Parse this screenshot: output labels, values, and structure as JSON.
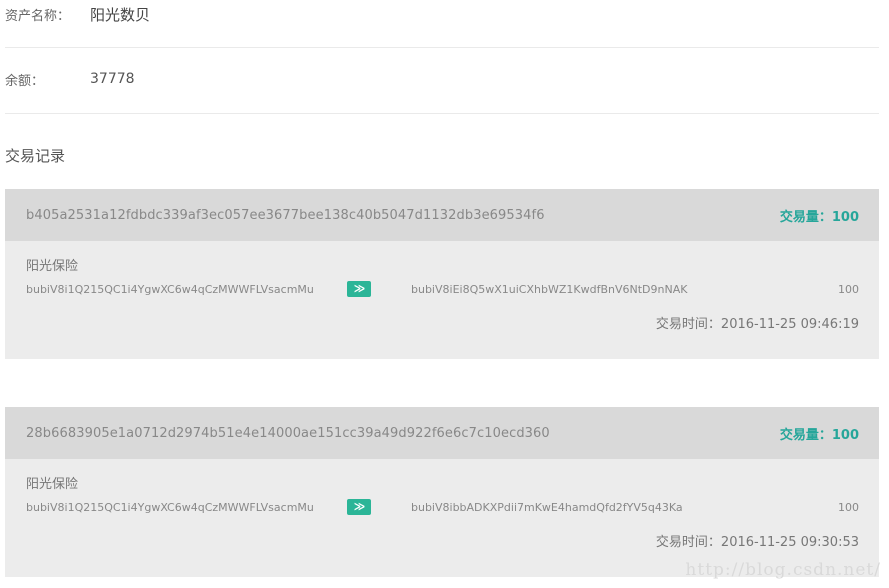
{
  "asset": {
    "label": "资产名称：",
    "value": "阳光数贝"
  },
  "balance": {
    "label": "余额：",
    "value": "37778"
  },
  "records": {
    "title": "交易记录",
    "items": [
      {
        "hash": "b405a2531a12fdbdc339af3ec057ee3677bee138c40b5047d1132db3e69534f6",
        "amount_label": "交易量：100",
        "company": "阳光保险",
        "from": "bubiV8i1Q215QC1i4YgwXC6w4qCzMWWFLVsacmMu",
        "arrow": "≫",
        "to": "bubiV8iEi8Q5wX1uiCXhbWZ1KwdfBnV6NtD9nNAK",
        "qty": "100",
        "time": "交易时间：2016-11-25 09:46:19"
      },
      {
        "hash": "28b6683905e1a0712d2974b51e4e14000ae151cc39a49d922f6e6c7c10ecd360",
        "amount_label": "交易量：100",
        "company": "阳光保险",
        "from": "bubiV8i1Q215QC1i4YgwXC6w4qCzMWWFLVsacmMu",
        "arrow": "≫",
        "to": "bubiV8ibbADKXPdii7mKwE4hamdQfd2fYV5q43Ka",
        "qty": "100",
        "time": "交易时间：2016-11-25 09:30:53"
      }
    ]
  },
  "watermark": "http://blog.csdn.net/"
}
